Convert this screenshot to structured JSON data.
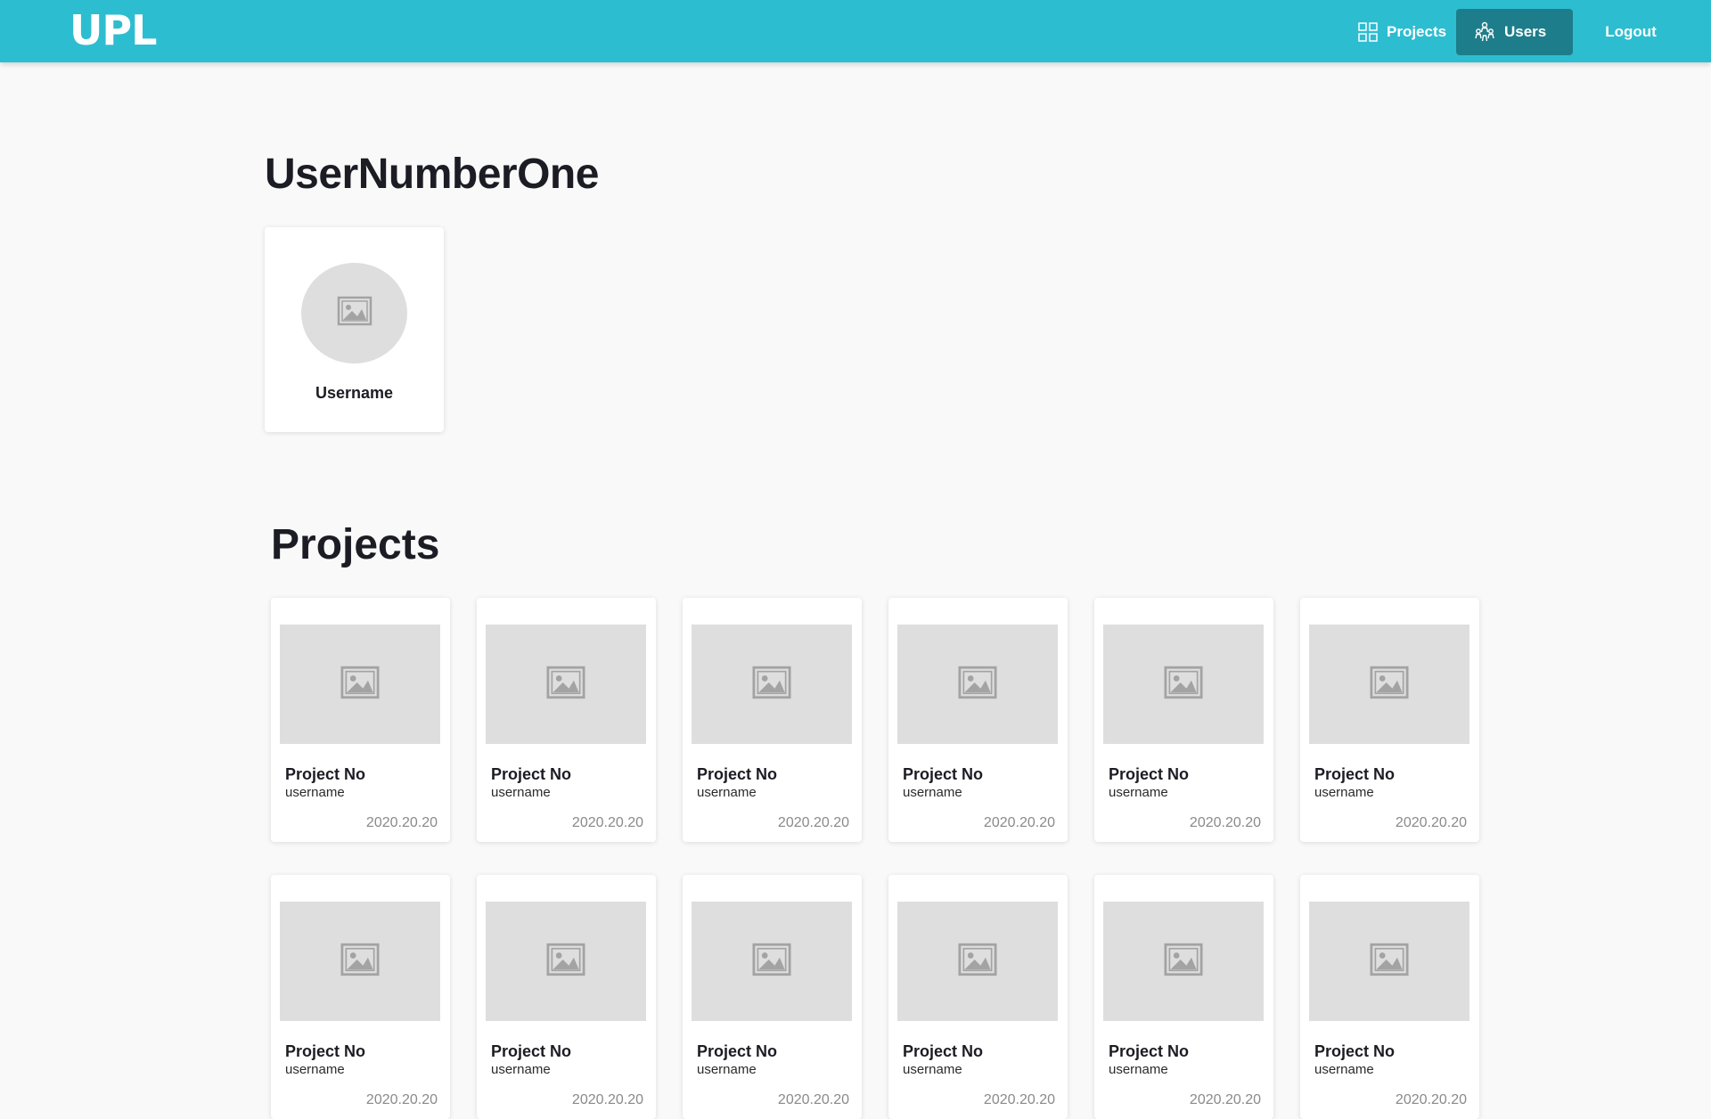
{
  "header": {
    "logo": "UPL",
    "nav": {
      "projects_label": "Projects",
      "users_label": "Users",
      "logout_label": "Logout"
    },
    "colors": {
      "bar": "#2dbdd0",
      "active": "#1e7d8a"
    }
  },
  "user": {
    "title": "UserNumberOne",
    "card_name": "Username",
    "avatar_icon": "image-placeholder-icon"
  },
  "projects": {
    "title": "Projects",
    "items": [
      {
        "title": "Project No",
        "user": "username",
        "date": "2020.20.20"
      },
      {
        "title": "Project No",
        "user": "username",
        "date": "2020.20.20"
      },
      {
        "title": "Project No",
        "user": "username",
        "date": "2020.20.20"
      },
      {
        "title": "Project No",
        "user": "username",
        "date": "2020.20.20"
      },
      {
        "title": "Project No",
        "user": "username",
        "date": "2020.20.20"
      },
      {
        "title": "Project No",
        "user": "username",
        "date": "2020.20.20"
      },
      {
        "title": "Project No",
        "user": "username",
        "date": "2020.20.20"
      },
      {
        "title": "Project No",
        "user": "username",
        "date": "2020.20.20"
      },
      {
        "title": "Project No",
        "user": "username",
        "date": "2020.20.20"
      },
      {
        "title": "Project No",
        "user": "username",
        "date": "2020.20.20"
      },
      {
        "title": "Project No",
        "user": "username",
        "date": "2020.20.20"
      },
      {
        "title": "Project No",
        "user": "username",
        "date": "2020.20.20"
      }
    ]
  }
}
